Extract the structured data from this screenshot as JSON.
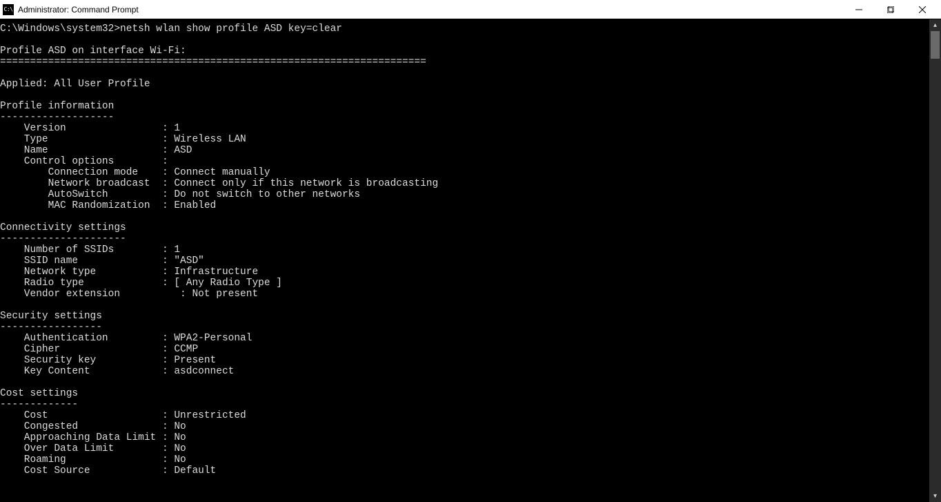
{
  "titlebar": {
    "icon_text": "C:\\",
    "title": "Administrator: Command Prompt"
  },
  "prompt": {
    "path": "C:\\Windows\\system32>",
    "command": "netsh wlan show profile ASD key=clear"
  },
  "header": {
    "profile_line": "Profile ASD on interface Wi-Fi:",
    "divider": "=======================================================================",
    "applied": "Applied: All User Profile"
  },
  "sections": {
    "profile_info": {
      "title": "Profile information",
      "dashes": "-------------------",
      "rows": [
        {
          "label": "Version",
          "value": "1"
        },
        {
          "label": "Type",
          "value": "Wireless LAN"
        },
        {
          "label": "Name",
          "value": "ASD"
        },
        {
          "label": "Control options",
          "value": ""
        }
      ],
      "sub_rows": [
        {
          "label": "Connection mode",
          "value": "Connect manually"
        },
        {
          "label": "Network broadcast",
          "value": "Connect only if this network is broadcasting"
        },
        {
          "label": "AutoSwitch",
          "value": "Do not switch to other networks"
        },
        {
          "label": "MAC Randomization",
          "value": "Enabled"
        }
      ]
    },
    "connectivity": {
      "title": "Connectivity settings",
      "dashes": "---------------------",
      "rows": [
        {
          "label": "Number of SSIDs",
          "value": "1"
        },
        {
          "label": "SSID name",
          "value": "\"ASD\""
        },
        {
          "label": "Network type",
          "value": "Infrastructure"
        },
        {
          "label": "Radio type",
          "value": "[ Any Radio Type ]"
        }
      ],
      "vendor_row": {
        "label": "Vendor extension",
        "value": "Not present"
      }
    },
    "security": {
      "title": "Security settings",
      "dashes": "-----------------",
      "rows": [
        {
          "label": "Authentication",
          "value": "WPA2-Personal"
        },
        {
          "label": "Cipher",
          "value": "CCMP"
        },
        {
          "label": "Security key",
          "value": "Present"
        },
        {
          "label": "Key Content",
          "value": "asdconnect"
        }
      ]
    },
    "cost": {
      "title": "Cost settings",
      "dashes": "-------------",
      "rows": [
        {
          "label": "Cost",
          "value": "Unrestricted"
        },
        {
          "label": "Congested",
          "value": "No"
        },
        {
          "label": "Approaching Data Limit",
          "value": "No"
        },
        {
          "label": "Over Data Limit",
          "value": "No"
        },
        {
          "label": "Roaming",
          "value": "No"
        },
        {
          "label": "Cost Source",
          "value": "Default"
        }
      ]
    }
  }
}
